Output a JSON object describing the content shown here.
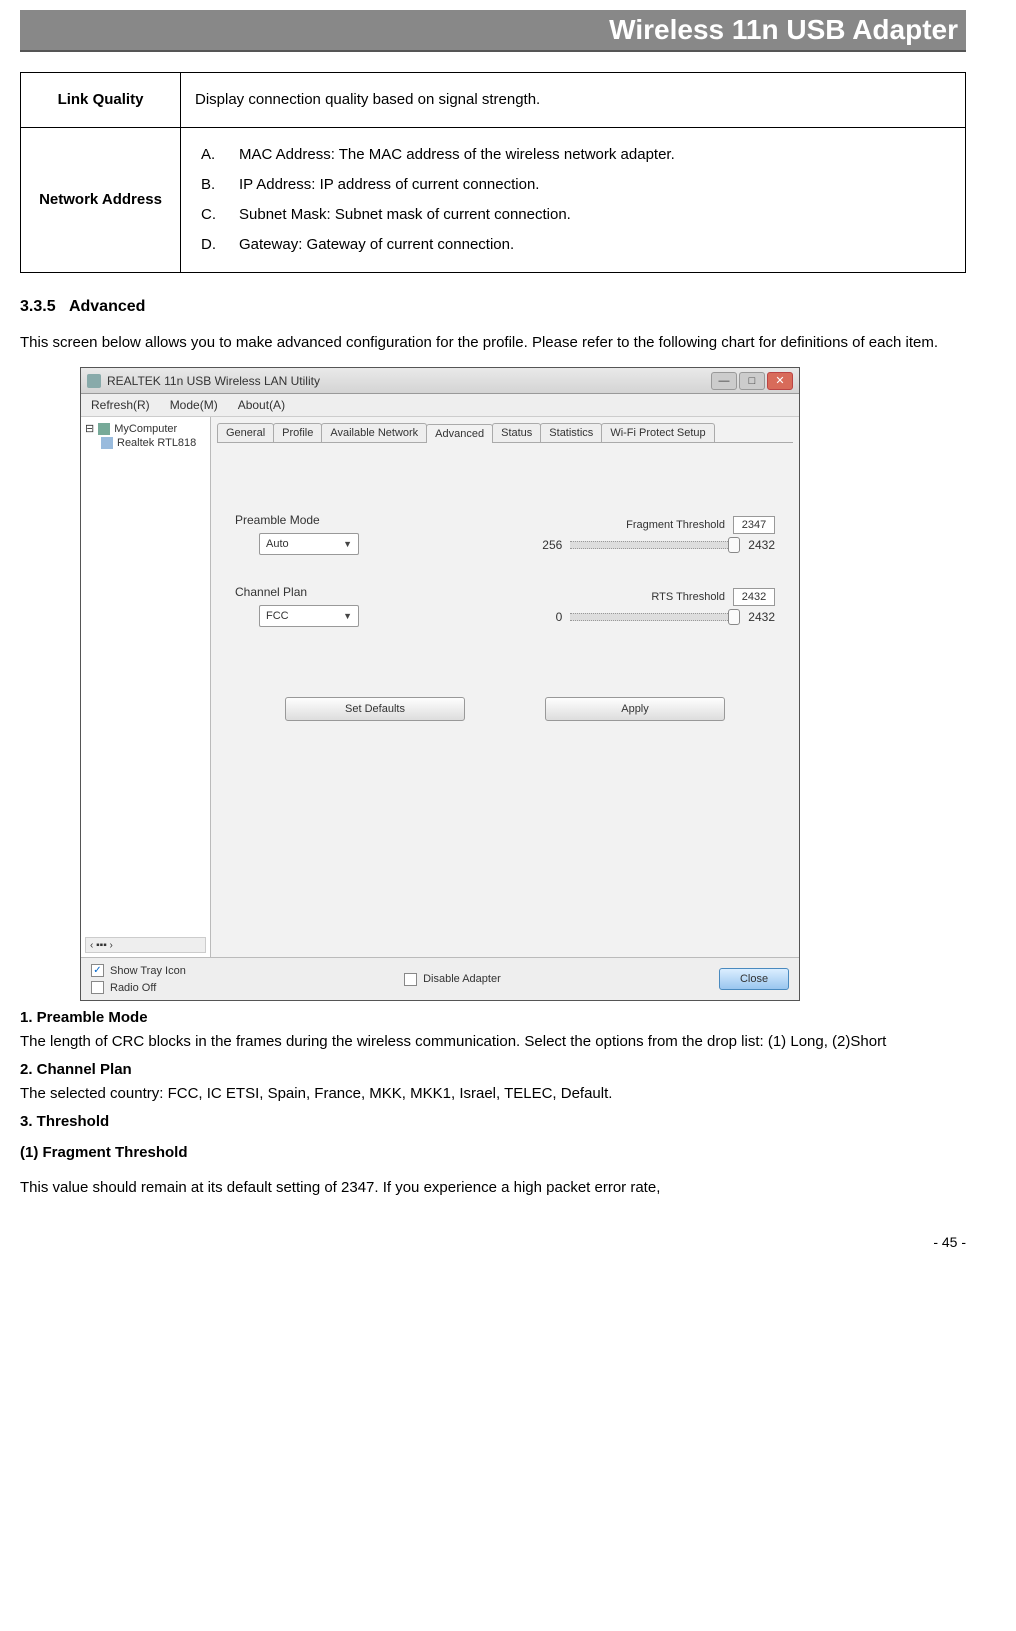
{
  "header": {
    "title": "Wireless 11n USB Adapter"
  },
  "table": {
    "rows": [
      {
        "label": "Link Quality",
        "text": "Display connection quality based on signal strength."
      },
      {
        "label": "Network Address",
        "items": [
          {
            "letter": "A.",
            "text": "MAC Address: The MAC address of the wireless network adapter."
          },
          {
            "letter": "B.",
            "text": "IP Address: IP address of current connection."
          },
          {
            "letter": "C.",
            "text": "Subnet Mask: Subnet mask of current connection."
          },
          {
            "letter": "D.",
            "text": "Gateway: Gateway of current connection."
          }
        ]
      }
    ]
  },
  "section": {
    "number": "3.3.5",
    "title": "Advanced",
    "intro": "This screen below allows you to make advanced configuration for the profile. Please refer to the following chart for definitions of each item."
  },
  "app": {
    "title": "REALTEK 11n USB Wireless LAN Utility",
    "menu": [
      "Refresh(R)",
      "Mode(M)",
      "About(A)"
    ],
    "tree": {
      "root": "MyComputer",
      "child": "Realtek RTL818"
    },
    "tabs": [
      "General",
      "Profile",
      "Available Network",
      "Advanced",
      "Status",
      "Statistics",
      "Wi-Fi Protect Setup"
    ],
    "active_tab_index": 3,
    "preamble": {
      "label": "Preamble Mode",
      "value": "Auto"
    },
    "channel": {
      "label": "Channel Plan",
      "value": "FCC"
    },
    "frag": {
      "label": "Fragment Threshold",
      "value": "2347",
      "min": "256",
      "max": "2432"
    },
    "rts": {
      "label": "RTS Threshold",
      "value": "2432",
      "min": "0",
      "max": "2432"
    },
    "buttons": {
      "defaults": "Set Defaults",
      "apply": "Apply"
    },
    "footer": {
      "show_tray": {
        "label": "Show Tray Icon",
        "checked": true
      },
      "radio_off": {
        "label": "Radio Off",
        "checked": false
      },
      "disable": {
        "label": "Disable Adapter",
        "checked": false
      },
      "close": "Close"
    }
  },
  "below": {
    "h1": "1. Preamble Mode",
    "p1": "The length of CRC blocks in the frames during the wireless communication. Select the options from the drop list: (1) Long, (2)Short",
    "h2": "2. Channel Plan",
    "p2": "The selected country: FCC, IC ETSI, Spain, France, MKK, MKK1, Israel, TELEC, Default.",
    "h3": "3. Threshold",
    "h4": "(1) Fragment Threshold",
    "p4": "This value should remain at its default setting of 2347. If you experience a high packet error rate,"
  },
  "page_num": "- 45 -"
}
